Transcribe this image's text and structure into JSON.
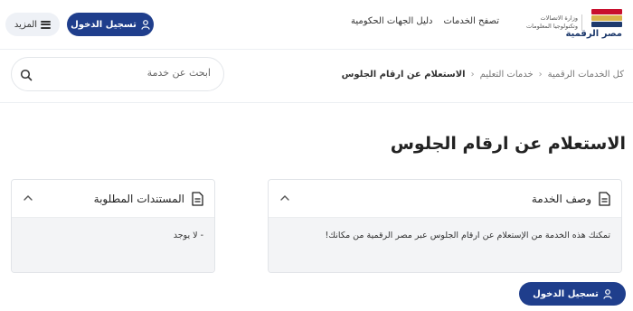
{
  "header": {
    "logo_name": "مصر الرقمية",
    "ministry_text": "وزارة الاتصالات وتكنولوجيا المعلومات",
    "nav": [
      "تصفح الخدمات",
      "دليل الجهات الحكومية"
    ],
    "login_label": "تسجيل الدخول",
    "more_label": "المزيد"
  },
  "breadcrumb": {
    "items": [
      "كل الخدمات الرقمية",
      "خدمات التعليم"
    ],
    "current": "الاستعلام عن ارقام الجلوس"
  },
  "search": {
    "placeholder": "ابحث عن خدمة"
  },
  "page": {
    "title": "الاستعلام عن ارقام الجلوس"
  },
  "description_card": {
    "title": "وصف الخدمة",
    "body": "تمكنك هذه الخدمة من الإستعلام عن ارقام الجلوس عبر مصر الرقمية من مكانك!"
  },
  "documents_card": {
    "title": "المستندات المطلوبة",
    "body": "- لا يوجد"
  },
  "footer": {
    "login_label": "تسجيل الدخول"
  },
  "colors": {
    "primary": "#1f3e8c",
    "card_body_bg": "#f3f4f6"
  },
  "icons": [
    "user-icon",
    "menu-icon",
    "search-icon",
    "document-icon",
    "chevron-up-icon",
    "chevron-left-icon"
  ]
}
